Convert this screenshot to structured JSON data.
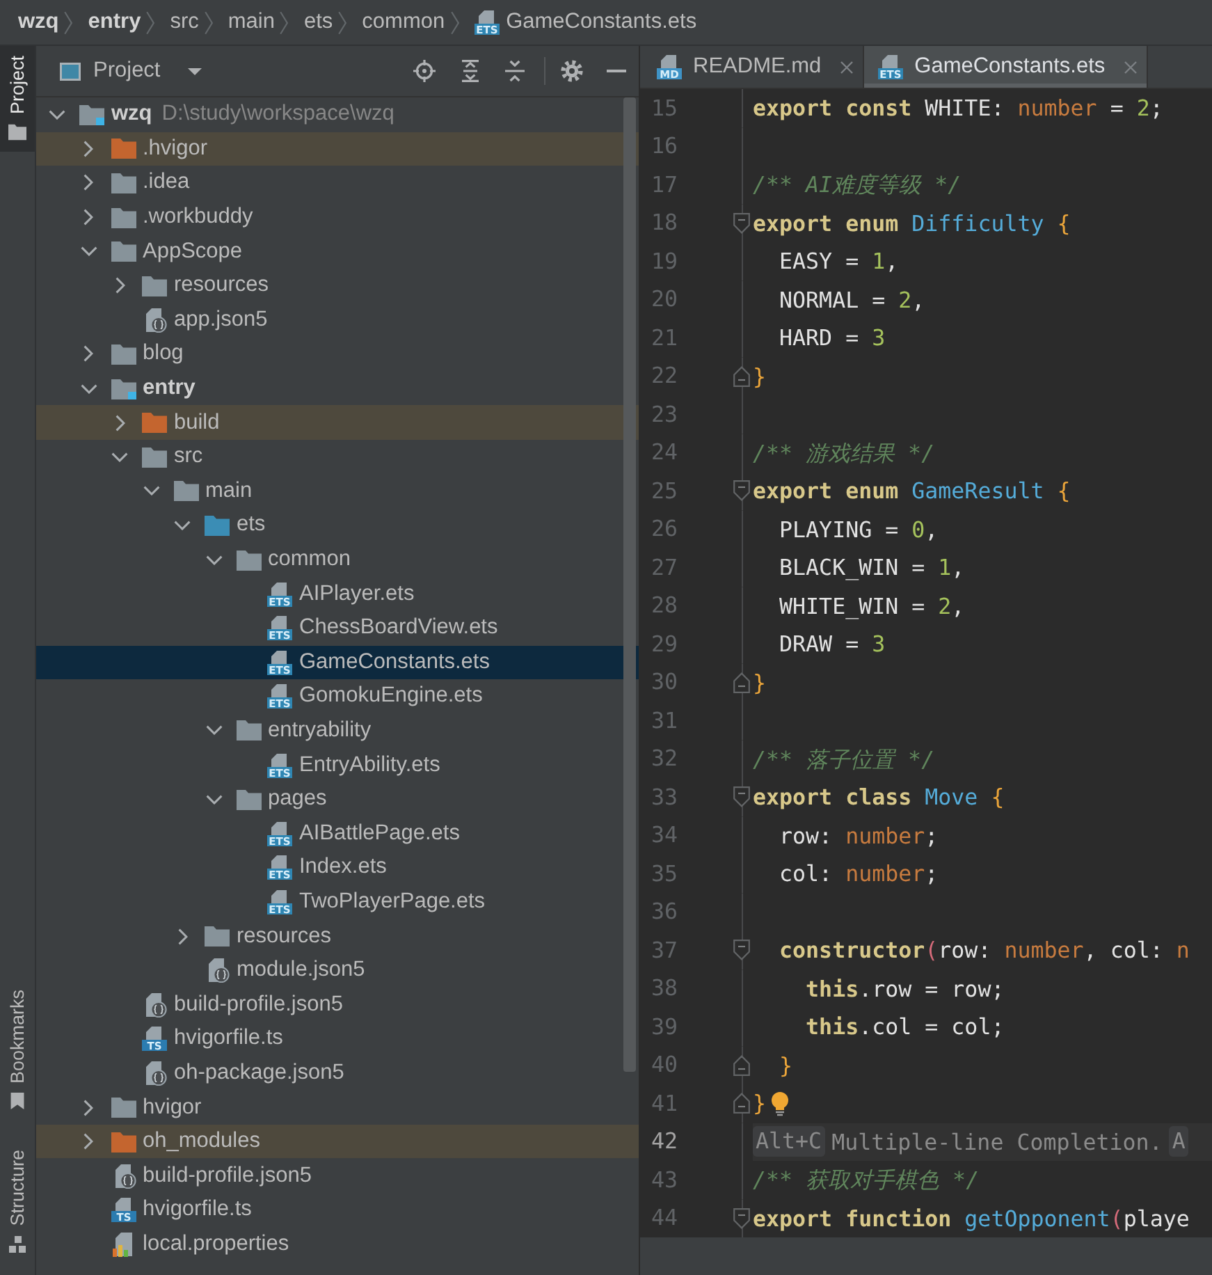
{
  "breadcrumbs": [
    {
      "label": "wzq",
      "kind": "module"
    },
    {
      "label": "entry",
      "kind": "module"
    },
    {
      "label": "src",
      "kind": "folder"
    },
    {
      "label": "main",
      "kind": "folder"
    },
    {
      "label": "ets",
      "kind": "folder"
    },
    {
      "label": "common",
      "kind": "folder"
    },
    {
      "label": "GameConstants.ets",
      "kind": "ets",
      "badge": "ETS"
    }
  ],
  "tool_windows": {
    "top": [
      {
        "label": "Project",
        "kind": "project",
        "selected": true
      }
    ],
    "bottom": [
      {
        "label": "Bookmarks",
        "kind": "bookmarks",
        "selected": false
      },
      {
        "label": "Structure",
        "kind": "structure",
        "selected": false
      }
    ]
  },
  "project_panel": {
    "title": "Project",
    "tree": [
      {
        "label": "wzq",
        "path": "D:\\study\\workspace\\wzq",
        "kind": "module",
        "expanded": true,
        "selected": false,
        "children": [
          {
            "label": ".hvigor",
            "kind": "excluded",
            "expanded": false,
            "selected": false
          },
          {
            "label": ".idea",
            "kind": "folder",
            "expanded": false,
            "selected": false
          },
          {
            "label": ".workbuddy",
            "kind": "folder",
            "expanded": false,
            "selected": false
          },
          {
            "label": "AppScope",
            "kind": "folder",
            "expanded": true,
            "selected": false,
            "children": [
              {
                "label": "resources",
                "kind": "folder",
                "expanded": false,
                "selected": false
              },
              {
                "label": "app.json5",
                "kind": "json",
                "selected": false
              }
            ]
          },
          {
            "label": "blog",
            "kind": "folder",
            "expanded": false,
            "selected": false
          },
          {
            "label": "entry",
            "kind": "module",
            "expanded": true,
            "selected": false,
            "children": [
              {
                "label": "build",
                "kind": "excluded",
                "expanded": false,
                "selected": false
              },
              {
                "label": "src",
                "kind": "folder",
                "expanded": true,
                "selected": false,
                "children": [
                  {
                    "label": "main",
                    "kind": "folder",
                    "expanded": true,
                    "selected": false,
                    "children": [
                      {
                        "label": "ets",
                        "kind": "source",
                        "expanded": true,
                        "selected": false,
                        "children": [
                          {
                            "label": "common",
                            "kind": "folder",
                            "expanded": true,
                            "selected": false,
                            "children": [
                              {
                                "label": "AIPlayer.ets",
                                "kind": "ets",
                                "badge": "ETS",
                                "selected": false
                              },
                              {
                                "label": "ChessBoardView.ets",
                                "kind": "ets",
                                "badge": "ETS",
                                "selected": false
                              },
                              {
                                "label": "GameConstants.ets",
                                "kind": "ets",
                                "badge": "ETS",
                                "selected": true
                              },
                              {
                                "label": "GomokuEngine.ets",
                                "kind": "ets",
                                "badge": "ETS",
                                "selected": false
                              }
                            ]
                          },
                          {
                            "label": "entryability",
                            "kind": "folder",
                            "expanded": true,
                            "selected": false,
                            "children": [
                              {
                                "label": "EntryAbility.ets",
                                "kind": "ets",
                                "badge": "ETS",
                                "selected": false
                              }
                            ]
                          },
                          {
                            "label": "pages",
                            "kind": "folder",
                            "expanded": true,
                            "selected": false,
                            "children": [
                              {
                                "label": "AIBattlePage.ets",
                                "kind": "ets",
                                "badge": "ETS",
                                "selected": false
                              },
                              {
                                "label": "Index.ets",
                                "kind": "ets",
                                "badge": "ETS",
                                "selected": false
                              },
                              {
                                "label": "TwoPlayerPage.ets",
                                "kind": "ets",
                                "badge": "ETS",
                                "selected": false
                              }
                            ]
                          }
                        ]
                      },
                      {
                        "label": "resources",
                        "kind": "folder",
                        "expanded": false,
                        "selected": false
                      },
                      {
                        "label": "module.json5",
                        "kind": "json",
                        "selected": false
                      }
                    ]
                  }
                ]
              },
              {
                "label": "build-profile.json5",
                "kind": "json",
                "selected": false
              },
              {
                "label": "hvigorfile.ts",
                "kind": "ts",
                "badge": "TS",
                "selected": false
              },
              {
                "label": "oh-package.json5",
                "kind": "json",
                "selected": false
              }
            ]
          },
          {
            "label": "hvigor",
            "kind": "folder",
            "expanded": false,
            "selected": false
          },
          {
            "label": "oh_modules",
            "kind": "excluded",
            "expanded": false,
            "selected": false
          },
          {
            "label": "build-profile.json5",
            "kind": "json",
            "selected": false
          },
          {
            "label": "hvigorfile.ts",
            "kind": "ts",
            "badge": "TS",
            "selected": false
          },
          {
            "label": "local.properties",
            "kind": "properties",
            "selected": false
          }
        ]
      }
    ]
  },
  "editor": {
    "tabs": [
      {
        "label": "README.md",
        "kind": "md",
        "badge": "MD",
        "selected": false
      },
      {
        "label": "GameConstants.ets",
        "kind": "ets",
        "badge": "ETS",
        "selected": true
      }
    ],
    "lines": [
      {
        "number": "15",
        "current": false,
        "tokens": [
          {
            "kind": "keyword",
            "text": "export const"
          },
          {
            "kind": "plain",
            "text": " WHITE: "
          },
          {
            "kind": "type",
            "text": "number"
          },
          {
            "kind": "plain",
            "text": " = "
          },
          {
            "kind": "number",
            "text": "2"
          },
          {
            "kind": "plain",
            "text": ";"
          }
        ]
      },
      {
        "number": "16",
        "current": false
      },
      {
        "number": "17",
        "current": false,
        "tokens": [
          {
            "kind": "comment",
            "text": "/** AI难度等级 */"
          }
        ]
      },
      {
        "number": "18",
        "current": false,
        "fold_start": true,
        "tokens": [
          {
            "kind": "keyword",
            "text": "export enum "
          },
          {
            "kind": "name",
            "text": "Difficulty "
          },
          {
            "kind": "brace",
            "text": "{"
          }
        ]
      },
      {
        "number": "19",
        "current": false,
        "tokens": [
          {
            "kind": "plain",
            "text": "  EASY = "
          },
          {
            "kind": "number",
            "text": "1"
          },
          {
            "kind": "plain",
            "text": ","
          }
        ]
      },
      {
        "number": "20",
        "current": false,
        "tokens": [
          {
            "kind": "plain",
            "text": "  NORMAL = "
          },
          {
            "kind": "number",
            "text": "2"
          },
          {
            "kind": "plain",
            "text": ","
          }
        ]
      },
      {
        "number": "21",
        "current": false,
        "tokens": [
          {
            "kind": "plain",
            "text": "  HARD = "
          },
          {
            "kind": "number",
            "text": "3"
          }
        ]
      },
      {
        "number": "22",
        "current": false,
        "fold_end": true,
        "tokens": [
          {
            "kind": "brace",
            "text": "}"
          }
        ]
      },
      {
        "number": "23",
        "current": false
      },
      {
        "number": "24",
        "current": false,
        "tokens": [
          {
            "kind": "comment",
            "text": "/** 游戏结果 */"
          }
        ]
      },
      {
        "number": "25",
        "current": false,
        "fold_start": true,
        "tokens": [
          {
            "kind": "keyword",
            "text": "export enum "
          },
          {
            "kind": "name",
            "text": "GameResult "
          },
          {
            "kind": "brace",
            "text": "{"
          }
        ]
      },
      {
        "number": "26",
        "current": false,
        "tokens": [
          {
            "kind": "plain",
            "text": "  PLAYING = "
          },
          {
            "kind": "number",
            "text": "0"
          },
          {
            "kind": "plain",
            "text": ","
          }
        ]
      },
      {
        "number": "27",
        "current": false,
        "tokens": [
          {
            "kind": "plain",
            "text": "  BLACK_WIN = "
          },
          {
            "kind": "number",
            "text": "1"
          },
          {
            "kind": "plain",
            "text": ","
          }
        ]
      },
      {
        "number": "28",
        "current": false,
        "tokens": [
          {
            "kind": "plain",
            "text": "  WHITE_WIN = "
          },
          {
            "kind": "number",
            "text": "2"
          },
          {
            "kind": "plain",
            "text": ","
          }
        ]
      },
      {
        "number": "29",
        "current": false,
        "tokens": [
          {
            "kind": "plain",
            "text": "  DRAW = "
          },
          {
            "kind": "number",
            "text": "3"
          }
        ]
      },
      {
        "number": "30",
        "current": false,
        "fold_end": true,
        "tokens": [
          {
            "kind": "brace",
            "text": "}"
          }
        ]
      },
      {
        "number": "31",
        "current": false
      },
      {
        "number": "32",
        "current": false,
        "tokens": [
          {
            "kind": "comment",
            "text": "/** 落子位置 */"
          }
        ]
      },
      {
        "number": "33",
        "current": false,
        "fold_start": true,
        "tokens": [
          {
            "kind": "keyword",
            "text": "export class "
          },
          {
            "kind": "name",
            "text": "Move "
          },
          {
            "kind": "brace",
            "text": "{"
          }
        ]
      },
      {
        "number": "34",
        "current": false,
        "tokens": [
          {
            "kind": "plain",
            "text": "  row: "
          },
          {
            "kind": "type",
            "text": "number"
          },
          {
            "kind": "plain",
            "text": ";"
          }
        ]
      },
      {
        "number": "35",
        "current": false,
        "tokens": [
          {
            "kind": "plain",
            "text": "  col: "
          },
          {
            "kind": "type",
            "text": "number"
          },
          {
            "kind": "plain",
            "text": ";"
          }
        ]
      },
      {
        "number": "36",
        "current": false
      },
      {
        "number": "37",
        "current": false,
        "fold_start": true,
        "tokens": [
          {
            "kind": "keyword",
            "text": "  constructor"
          },
          {
            "kind": "paren",
            "text": "("
          },
          {
            "kind": "plain",
            "text": "row: "
          },
          {
            "kind": "type",
            "text": "number"
          },
          {
            "kind": "plain",
            "text": ", col: "
          },
          {
            "kind": "type",
            "text": "n"
          }
        ]
      },
      {
        "number": "38",
        "current": false,
        "tokens": [
          {
            "kind": "keyword",
            "text": "    this"
          },
          {
            "kind": "plain",
            "text": ".row = row;"
          }
        ]
      },
      {
        "number": "39",
        "current": false,
        "tokens": [
          {
            "kind": "keyword",
            "text": "    this"
          },
          {
            "kind": "plain",
            "text": ".col = col;"
          }
        ]
      },
      {
        "number": "40",
        "current": false,
        "fold_end": true,
        "tokens": [
          {
            "kind": "brace",
            "text": "  }"
          }
        ]
      },
      {
        "number": "41",
        "current": false,
        "fold_end": true,
        "bulb": true,
        "tokens": [
          {
            "kind": "brace",
            "text": "}"
          }
        ]
      },
      {
        "number": "42",
        "current": true,
        "kind": "hint",
        "tokens": [
          {
            "kind": "key",
            "text": "Alt+C"
          },
          {
            "kind": "hint",
            "text": "Multiple-line Completion."
          },
          {
            "kind": "key",
            "text": "A"
          }
        ]
      },
      {
        "number": "43",
        "current": false,
        "tokens": [
          {
            "kind": "comment",
            "text": "/** 获取对手棋色 */"
          }
        ]
      },
      {
        "number": "44",
        "current": false,
        "fold_start": true,
        "tokens": [
          {
            "kind": "keyword",
            "text": "export function "
          },
          {
            "kind": "name",
            "text": "getOpponent"
          },
          {
            "kind": "paren",
            "text": "("
          },
          {
            "kind": "plain",
            "text": "playe"
          }
        ]
      }
    ]
  }
}
